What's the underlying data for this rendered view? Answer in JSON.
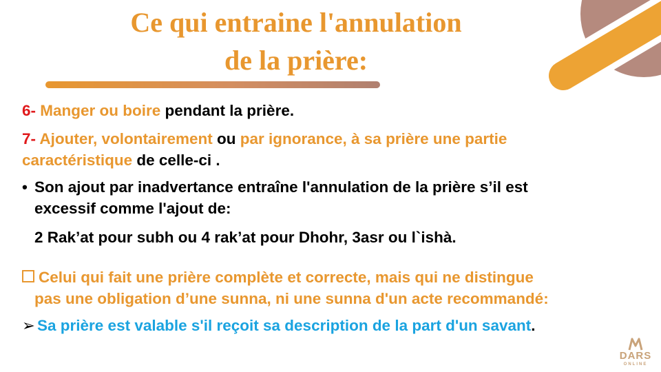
{
  "title": {
    "line1": "Ce qui entraine l'annulation",
    "line2": "de la prière",
    "line2_colon": ":"
  },
  "items": {
    "item6": {
      "number": "6-",
      "highlight": "Manger ou boire",
      "rest": " pendant la prière."
    },
    "item7": {
      "number": "7-",
      "part1": " Ajouter, volontairement",
      "connector": " ou ",
      "part2": "par ignorance, à sa prière une partie",
      "part3": "caractéristique",
      "rest": " de celle-ci ."
    }
  },
  "bullet": {
    "symbol": "•",
    "line1": "Son ajout par inadvertance entraîne l'annulation de la prière s’il est",
    "line2": "excessif comme l'ajout de:",
    "line3": "2 Rak’at pour subh ou 4 rak’at pour Dhohr, 3asr ou  l`ishà."
  },
  "note": {
    "line1": "Celui qui fait une prière complète et correcte, mais qui ne distingue",
    "line2": "pas une obligation d’une sunna, ni une sunna d'un acte recommandé:"
  },
  "conclusion": {
    "symbol": "➢",
    "text": "Sa prière est valable s'il reçoit sa description de la part d'un savant",
    "period": "."
  },
  "logo": {
    "text": "DARS",
    "subtext": "ONLINE"
  },
  "colors": {
    "orange": "#e8972f",
    "red": "#e0191b",
    "cyan": "#1aa3e0",
    "mauve": "#b58a7e"
  }
}
